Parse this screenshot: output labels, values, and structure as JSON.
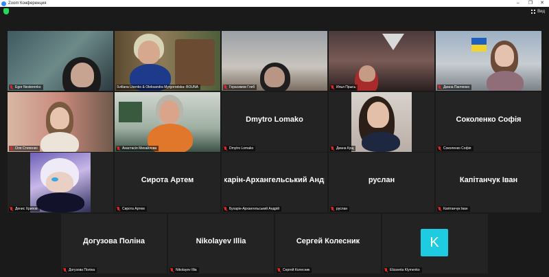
{
  "window": {
    "title": "Zoom Конференция",
    "minimize": "‒",
    "maximize": "❐",
    "close": "✕"
  },
  "toolbar": {
    "view_label": "Вид"
  },
  "participants": [
    {
      "tag": "Egor Nesterenko"
    },
    {
      "tag": "Svitlana Usenko & Oleksandra Myrgorodska- BOUNA"
    },
    {
      "tag": "Герасимов Глеб"
    },
    {
      "tag": "Илья Прысь"
    },
    {
      "tag": "Диана Панченко"
    },
    {
      "tag": "Оля Степенко"
    },
    {
      "tag": "Анастасія Михайлова"
    },
    {
      "name": "Dmytro Lomako",
      "tag": "Dmytro Lomako"
    },
    {
      "tag": "Диана Кущ"
    },
    {
      "name": "Соколенко Софія",
      "tag": "Соколенко Софія"
    },
    {
      "tag": "Денис Хрипов"
    },
    {
      "name": "Сирота Артем",
      "tag": "Сирота Артем"
    },
    {
      "name": "Бухарін-Архангельський Андрій",
      "tag": "Бухарін-Архангельський Андрій"
    },
    {
      "name": "руслан",
      "tag": "руслан"
    },
    {
      "name": "Капітанчук Іван",
      "tag": "Капітанчук Іван"
    },
    {
      "name": "Догузова Поліна",
      "tag": "Догузова Поліна"
    },
    {
      "name": "Nikolayev Illia",
      "tag": "Nikolayev Illia"
    },
    {
      "name": "Сергей Колесник",
      "tag": "Сергей Колесник"
    },
    {
      "tag": "Elizaveta Klymenko",
      "avatar_letter": "K"
    }
  ],
  "colors": {
    "active_speaker": "#e8d200",
    "muted": "#e02828",
    "avatar_bg": "#1ecbe1",
    "tile_bg": "#232323"
  }
}
